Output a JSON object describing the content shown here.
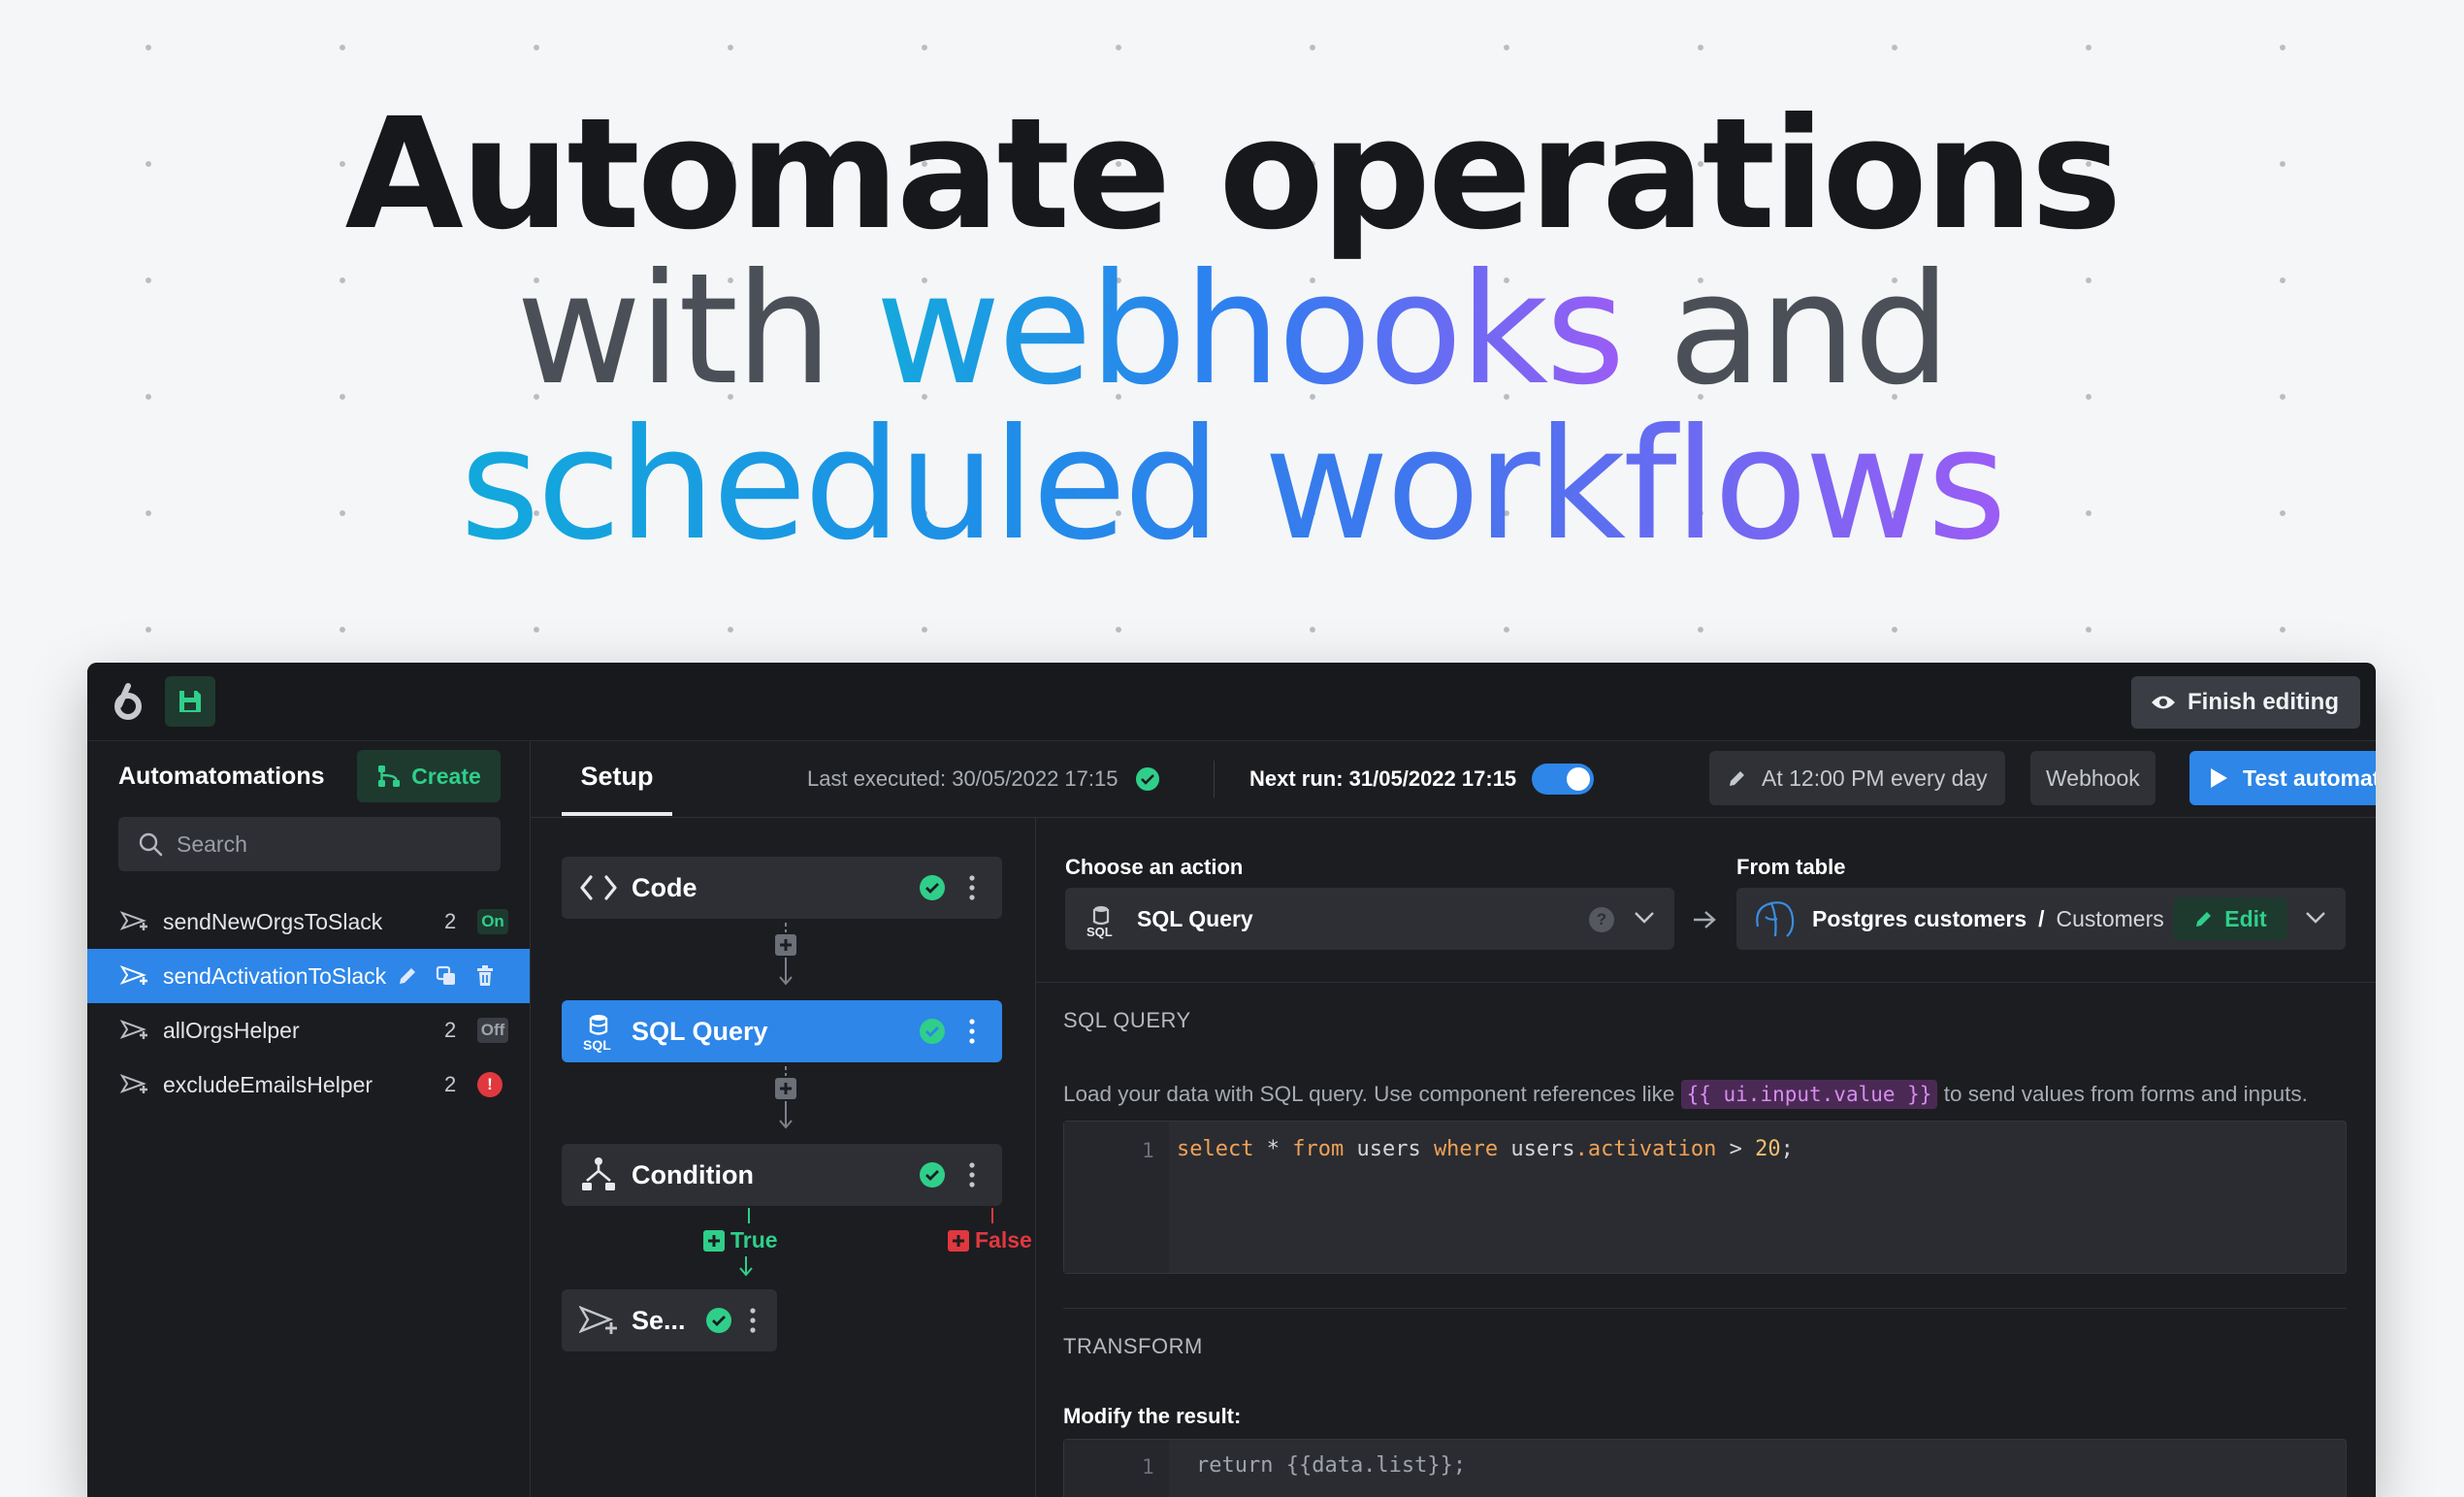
{
  "headline": {
    "line1": "Automate operations",
    "line2_plain_a": "with ",
    "line2_highlight": "webhooks",
    "line2_plain_b": " and",
    "line3": "scheduled workflows"
  },
  "topbar": {
    "finish_label": "Finish editing"
  },
  "sidebar": {
    "title": "Automatomations",
    "create_label": "Create",
    "search_placeholder": "Search",
    "items": [
      {
        "label": "sendNewOrgsToSlack",
        "count": "2",
        "status": "On"
      },
      {
        "label": "sendActivationToSlack",
        "count": "",
        "status": ""
      },
      {
        "label": "allOrgsHelper",
        "count": "2",
        "status": "Off"
      },
      {
        "label": "excludeEmailsHelper",
        "count": "2",
        "status": "!"
      }
    ]
  },
  "header": {
    "tab": "Setup",
    "last_executed": "Last executed: 30/05/2022 17:15",
    "next_run": "Next run: 31/05/2022 17:15",
    "schedule": "At 12:00 PM every day",
    "webhook": "Webhook",
    "test_label": "Test automation"
  },
  "flow": {
    "nodes": [
      {
        "label": "Code"
      },
      {
        "label": "SQL Query",
        "icon_text": "SQL"
      },
      {
        "label": "Condition"
      },
      {
        "label": "Se..."
      }
    ],
    "true_label": "True",
    "false_label": "False"
  },
  "detail": {
    "choose_action_label": "Choose an action",
    "action_value": "SQL Query",
    "action_icon_text": "SQL",
    "help_glyph": "?",
    "from_table_label": "From table",
    "resource": "Postgres customers",
    "separator": "/",
    "table": "Customers",
    "edit_label": "Edit",
    "sql_section": "SQL QUERY",
    "sql_hint_before": "Load your data with SQL query. Use component references like ",
    "sql_hint_code": "{{ ui.input.value }}",
    "sql_hint_after": " to send values from forms and inputs.",
    "sql_line_number": "1",
    "sql": {
      "t1": "select",
      "t2": " * ",
      "t3": "from",
      "t4": " users ",
      "t5": "where",
      "t6": " users",
      "t7": ".activation",
      "t8": " > ",
      "t9": "20",
      "t10": ";"
    },
    "transform_section": "TRANSFORM",
    "modify_label": "Modify the result:",
    "transform_line_number": "1",
    "transform_code": "return {{data.list}};"
  },
  "colors": {
    "accent_blue": "#2d86e8",
    "success_green": "#2fcf8a",
    "error_red": "#e0383e"
  }
}
